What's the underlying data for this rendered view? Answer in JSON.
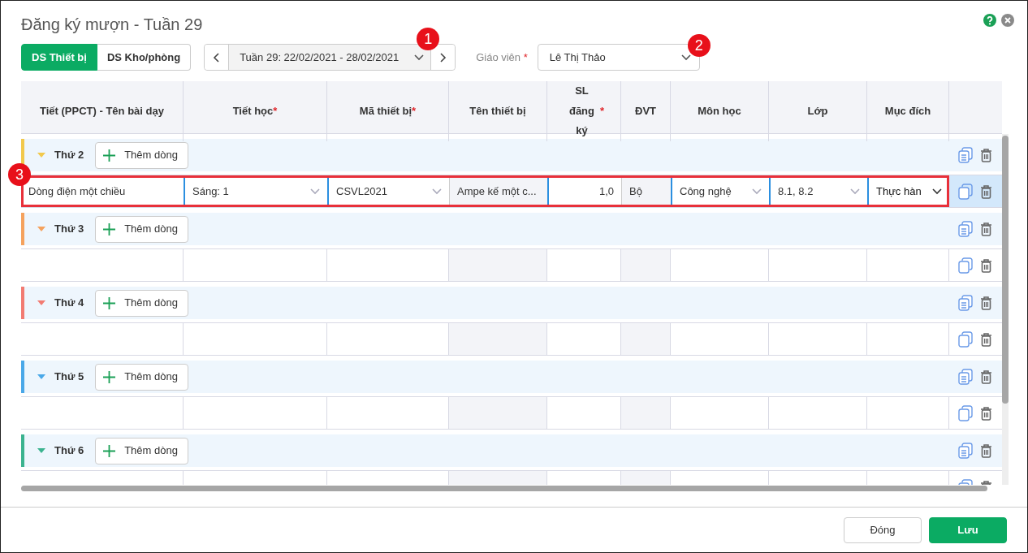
{
  "dialog": {
    "title": "Đăng ký mượn - Tuần 29"
  },
  "view_tabs": [
    {
      "label": "DS Thiết bị",
      "selected": true
    },
    {
      "label": "DS Kho/phòng",
      "selected": false
    }
  ],
  "week_picker": {
    "value": "Tuần 29: 22/02/2021 - 28/02/2021",
    "callout": "1"
  },
  "teacher": {
    "label": "Giáo viên",
    "required_mark": "*",
    "value": "Lê Thị Thảo",
    "callout": "2"
  },
  "columns": [
    {
      "label": "Tiết (PPCT) - Tên bài dạy",
      "kind": "text"
    },
    {
      "label": "Tiết học",
      "required_mark": "*",
      "kind": "select"
    },
    {
      "label": "Mã thiết bị",
      "required_mark": "*",
      "kind": "select"
    },
    {
      "label": "Tên thiết bị",
      "kind": "readonly"
    },
    {
      "label": "SL đăng ký",
      "required_mark": "*",
      "kind": "number"
    },
    {
      "label": "ĐVT",
      "kind": "readonly"
    },
    {
      "label": "Môn học",
      "kind": "select"
    },
    {
      "label": "Lớp",
      "kind": "select"
    },
    {
      "label": "Mục đích",
      "kind": "dropdown"
    }
  ],
  "groups": [
    {
      "label": "Thứ 2",
      "color": "#f2c94c",
      "expanded": true,
      "add_button": "Thêm dòng",
      "rows": [
        {
          "highlighted": true,
          "callout": "3",
          "cells": [
            "Dòng điện một chiều",
            "Sáng: 1",
            "CSVL2021",
            "Ampe kế một c...",
            "1,0",
            "Bộ",
            "Công nghệ",
            "8.1, 8.2",
            "Thực hàn"
          ]
        }
      ]
    },
    {
      "label": "Thứ 3",
      "color": "#f5a25d",
      "expanded": true,
      "add_button": "Thêm dòng",
      "rows": [
        {
          "highlighted": false
        }
      ]
    },
    {
      "label": "Thứ 4",
      "color": "#f27b72",
      "expanded": true,
      "add_button": "Thêm dòng",
      "rows": [
        {
          "highlighted": false
        }
      ]
    },
    {
      "label": "Thứ 5",
      "color": "#4aa8e8",
      "expanded": true,
      "add_button": "Thêm dòng",
      "rows": [
        {
          "highlighted": false
        }
      ]
    },
    {
      "label": "Thứ 6",
      "color": "#3bb38f",
      "expanded": true,
      "add_button": "Thêm dòng",
      "rows": [
        {
          "highlighted": false
        }
      ]
    }
  ],
  "footer": {
    "buttons": [
      {
        "label": "Đóng",
        "kind": "secondary"
      },
      {
        "label": "Lưu",
        "kind": "primary"
      }
    ]
  }
}
